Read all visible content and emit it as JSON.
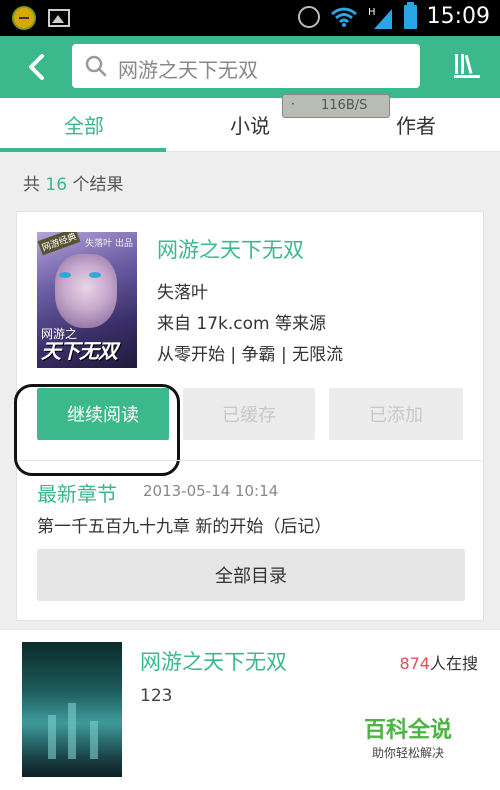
{
  "status_bar": {
    "time": "15:09",
    "network_type": "H",
    "icons": [
      "game-icon",
      "image-icon",
      "alarm-icon",
      "wifi-icon",
      "signal-icon",
      "battery-icon"
    ]
  },
  "app_bar": {
    "search_query": "网游之天下无双",
    "accent_color": "#3bb88c"
  },
  "tabs": [
    {
      "label": "全部",
      "active": true
    },
    {
      "label": "小说",
      "active": false
    },
    {
      "label": "作者",
      "active": false
    }
  ],
  "speed_overlay": {
    "dot": "·",
    "speed": "116B/S"
  },
  "results": {
    "prefix": "共",
    "count": "16",
    "suffix": "个结果"
  },
  "books": [
    {
      "title": "网游之天下无双",
      "author": "失落叶",
      "source": "来自 17k.com 等来源",
      "tags": "从零开始 | 争霸 | 无限流",
      "cover": {
        "tag": "网游经典",
        "publisher": "失落叶 出品",
        "subtitle": "网游之",
        "title": "天下无双"
      },
      "buttons": {
        "read": "继续阅读",
        "cached": "已缓存",
        "added": "已添加"
      },
      "latest": {
        "label": "最新章节",
        "time": "2013-05-14 10:14",
        "chapter": "第一千五百九十九章 新的开始（后记）"
      },
      "catalog_button": "全部目录"
    },
    {
      "title": "网游之天下无双",
      "search_count": "874",
      "search_suffix": "人在搜",
      "desc": "123"
    }
  ],
  "watermark": {
    "main": "百科全说",
    "sub": "助你轻松解决"
  }
}
